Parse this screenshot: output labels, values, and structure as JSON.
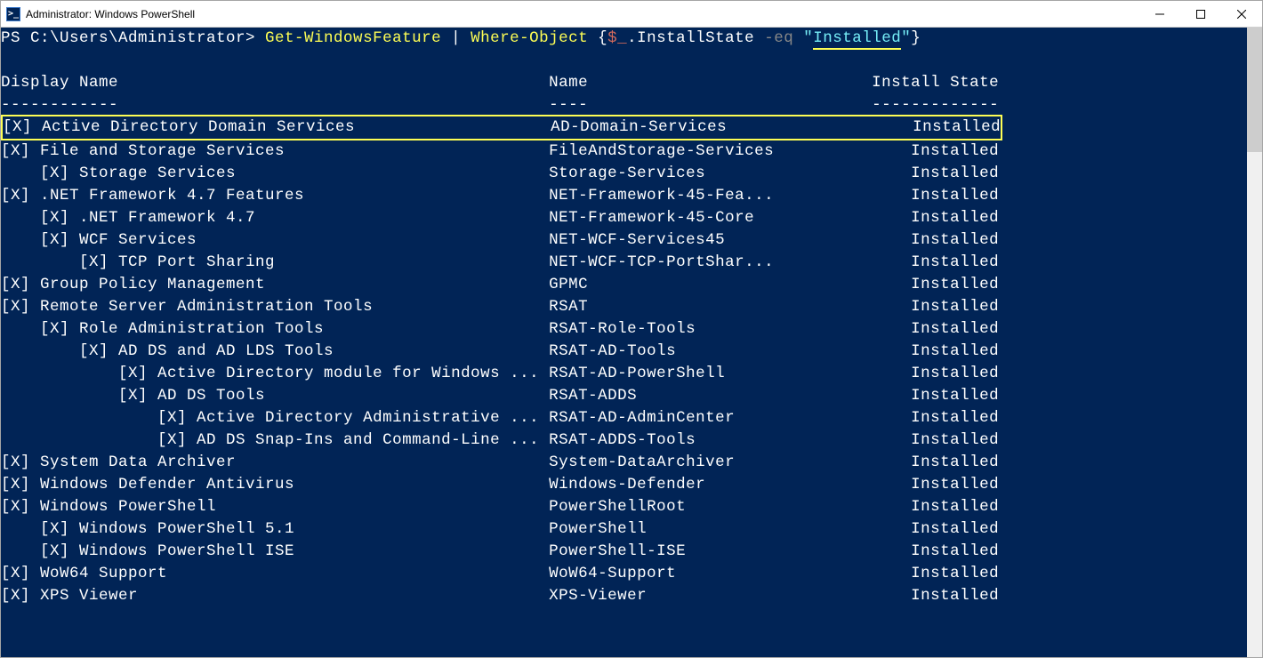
{
  "window": {
    "title": "Administrator: Windows PowerShell",
    "icon_label": ">_"
  },
  "command": {
    "prompt": "PS C:\\Users\\Administrator> ",
    "cmdlet1": "Get-WindowsFeature",
    "pipe": " | ",
    "cmdlet2": "Where-Object",
    "brace_open": " {",
    "varsym": "$_",
    "member": ".InstallState",
    "operator": " -eq ",
    "quote_open": "\"",
    "value": "Installed",
    "quote_close": "\"",
    "brace_close": "}"
  },
  "columns": {
    "display_name": "Display Name",
    "name": "Name",
    "install_state": "Install State",
    "dash_display": "------------",
    "dash_name": "----",
    "dash_state": "-------------"
  },
  "highlight_index": 0,
  "rows": [
    {
      "indent": 0,
      "display": "Active Directory Domain Services",
      "name": "AD-Domain-Services",
      "state": "Installed"
    },
    {
      "indent": 0,
      "display": "File and Storage Services",
      "name": "FileAndStorage-Services",
      "state": "Installed"
    },
    {
      "indent": 1,
      "display": "Storage Services",
      "name": "Storage-Services",
      "state": "Installed"
    },
    {
      "indent": 0,
      "display": ".NET Framework 4.7 Features",
      "name": "NET-Framework-45-Fea...",
      "state": "Installed"
    },
    {
      "indent": 1,
      "display": ".NET Framework 4.7",
      "name": "NET-Framework-45-Core",
      "state": "Installed"
    },
    {
      "indent": 1,
      "display": "WCF Services",
      "name": "NET-WCF-Services45",
      "state": "Installed"
    },
    {
      "indent": 2,
      "display": "TCP Port Sharing",
      "name": "NET-WCF-TCP-PortShar...",
      "state": "Installed"
    },
    {
      "indent": 0,
      "display": "Group Policy Management",
      "name": "GPMC",
      "state": "Installed"
    },
    {
      "indent": 0,
      "display": "Remote Server Administration Tools",
      "name": "RSAT",
      "state": "Installed"
    },
    {
      "indent": 1,
      "display": "Role Administration Tools",
      "name": "RSAT-Role-Tools",
      "state": "Installed"
    },
    {
      "indent": 2,
      "display": "AD DS and AD LDS Tools",
      "name": "RSAT-AD-Tools",
      "state": "Installed"
    },
    {
      "indent": 3,
      "display": "Active Directory module for Windows ...",
      "name": "RSAT-AD-PowerShell",
      "state": "Installed"
    },
    {
      "indent": 3,
      "display": "AD DS Tools",
      "name": "RSAT-ADDS",
      "state": "Installed"
    },
    {
      "indent": 4,
      "display": "Active Directory Administrative ...",
      "name": "RSAT-AD-AdminCenter",
      "state": "Installed"
    },
    {
      "indent": 4,
      "display": "AD DS Snap-Ins and Command-Line ...",
      "name": "RSAT-ADDS-Tools",
      "state": "Installed"
    },
    {
      "indent": 0,
      "display": "System Data Archiver",
      "name": "System-DataArchiver",
      "state": "Installed"
    },
    {
      "indent": 0,
      "display": "Windows Defender Antivirus",
      "name": "Windows-Defender",
      "state": "Installed"
    },
    {
      "indent": 0,
      "display": "Windows PowerShell",
      "name": "PowerShellRoot",
      "state": "Installed"
    },
    {
      "indent": 1,
      "display": "Windows PowerShell 5.1",
      "name": "PowerShell",
      "state": "Installed"
    },
    {
      "indent": 1,
      "display": "Windows PowerShell ISE",
      "name": "PowerShell-ISE",
      "state": "Installed"
    },
    {
      "indent": 0,
      "display": "WoW64 Support",
      "name": "WoW64-Support",
      "state": "Installed"
    },
    {
      "indent": 0,
      "display": "XPS Viewer",
      "name": "XPS-Viewer",
      "state": "Installed"
    }
  ],
  "layout": {
    "col_display_width": 56,
    "col_name_width": 33,
    "col_state_width": 13,
    "indent_unit": 4
  }
}
